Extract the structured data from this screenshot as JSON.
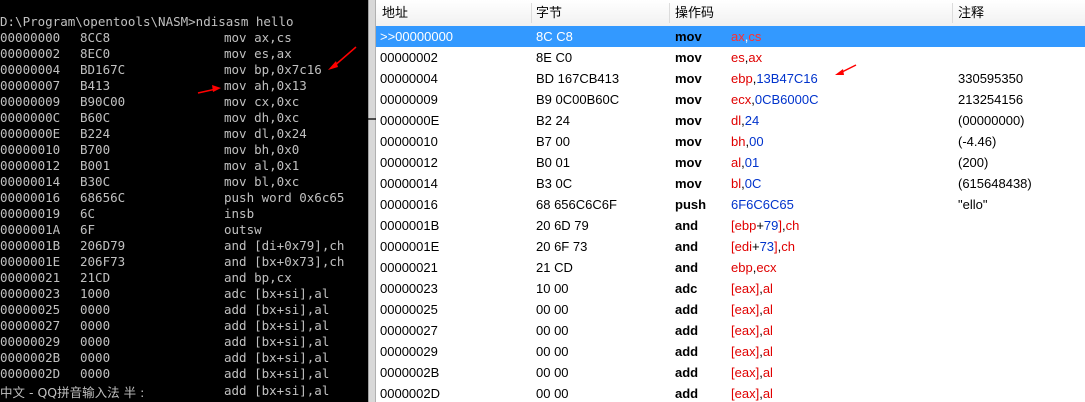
{
  "console": {
    "prompt": "D:\\Program\\opentools\\NASM>ndisasm hello",
    "lines": [
      {
        "addr": "00000000",
        "hex": "8CC8",
        "asm": "mov ax,cs"
      },
      {
        "addr": "00000002",
        "hex": "8EC0",
        "asm": "mov es,ax"
      },
      {
        "addr": "00000004",
        "hex": "BD167C",
        "asm": "mov bp,0x7c16"
      },
      {
        "addr": "00000007",
        "hex": "B413",
        "asm": "mov ah,0x13"
      },
      {
        "addr": "00000009",
        "hex": "B90C00",
        "asm": "mov cx,0xc"
      },
      {
        "addr": "0000000C",
        "hex": "B60C",
        "asm": "mov dh,0xc"
      },
      {
        "addr": "0000000E",
        "hex": "B224",
        "asm": "mov dl,0x24"
      },
      {
        "addr": "00000010",
        "hex": "B700",
        "asm": "mov bh,0x0"
      },
      {
        "addr": "00000012",
        "hex": "B001",
        "asm": "mov al,0x1"
      },
      {
        "addr": "00000014",
        "hex": "B30C",
        "asm": "mov bl,0xc"
      },
      {
        "addr": "00000016",
        "hex": "68656C",
        "asm": "push word 0x6c65"
      },
      {
        "addr": "00000019",
        "hex": "6C",
        "asm": "insb"
      },
      {
        "addr": "0000001A",
        "hex": "6F",
        "asm": "outsw"
      },
      {
        "addr": "0000001B",
        "hex": "206D79",
        "asm": "and [di+0x79],ch"
      },
      {
        "addr": "0000001E",
        "hex": "206F73",
        "asm": "and [bx+0x73],ch"
      },
      {
        "addr": "00000021",
        "hex": "21CD",
        "asm": "and bp,cx"
      },
      {
        "addr": "00000023",
        "hex": "1000",
        "asm": "adc [bx+si],al"
      },
      {
        "addr": "00000025",
        "hex": "0000",
        "asm": "add [bx+si],al"
      },
      {
        "addr": "00000027",
        "hex": "0000",
        "asm": "add [bx+si],al"
      },
      {
        "addr": "00000029",
        "hex": "0000",
        "asm": "add [bx+si],al"
      },
      {
        "addr": "0000002B",
        "hex": "0000",
        "asm": "add [bx+si],al"
      },
      {
        "addr": "0000002D",
        "hex": "0000",
        "asm": "add [bx+si],al"
      }
    ],
    "ime_status": "中文 - QQ拼音输入法 半 :",
    "last_line_asm": "add [bx+si],al"
  },
  "grid": {
    "headers": {
      "addr": "地址",
      "bytes": "字节",
      "opcode": "操作码",
      "comment": "注释"
    },
    "rows": [
      {
        "addr": ">>00000000",
        "bytes": "8C C8",
        "op": "mov",
        "args": [
          [
            "reg",
            "ax"
          ],
          [
            "sym",
            ","
          ],
          [
            "reg",
            "cs"
          ]
        ],
        "cmt": ""
      },
      {
        "addr": "00000002",
        "bytes": "8E C0",
        "op": "mov",
        "args": [
          [
            "reg",
            "es"
          ],
          [
            "sym",
            ","
          ],
          [
            "reg",
            "ax"
          ]
        ],
        "cmt": ""
      },
      {
        "addr": "00000004",
        "bytes": "BD 167CB413",
        "op": "mov",
        "args": [
          [
            "reg",
            "ebp"
          ],
          [
            "sym",
            ","
          ],
          [
            "num",
            "13B47C16"
          ]
        ],
        "cmt": "330595350"
      },
      {
        "addr": "00000009",
        "bytes": "B9 0C00B60C",
        "op": "mov",
        "args": [
          [
            "reg",
            "ecx"
          ],
          [
            "sym",
            ","
          ],
          [
            "num",
            "0CB6000C"
          ]
        ],
        "cmt": "213254156"
      },
      {
        "addr": "0000000E",
        "bytes": "B2 24",
        "op": "mov",
        "args": [
          [
            "reg",
            "dl"
          ],
          [
            "sym",
            ","
          ],
          [
            "num",
            "24"
          ]
        ],
        "cmt": "(00000000)"
      },
      {
        "addr": "00000010",
        "bytes": "B7 00",
        "op": "mov",
        "args": [
          [
            "reg",
            "bh"
          ],
          [
            "sym",
            ","
          ],
          [
            "num",
            "00"
          ]
        ],
        "cmt": "(-4.46)"
      },
      {
        "addr": "00000012",
        "bytes": "B0 01",
        "op": "mov",
        "args": [
          [
            "reg",
            "al"
          ],
          [
            "sym",
            ","
          ],
          [
            "num",
            "01"
          ]
        ],
        "cmt": "(200)"
      },
      {
        "addr": "00000014",
        "bytes": "B3 0C",
        "op": "mov",
        "args": [
          [
            "reg",
            "bl"
          ],
          [
            "sym",
            ","
          ],
          [
            "num",
            "0C"
          ]
        ],
        "cmt": "(615648438)"
      },
      {
        "addr": "00000016",
        "bytes": "68 656C6C6F",
        "op": "push",
        "args": [
          [
            "num",
            "6F6C6C65"
          ]
        ],
        "cmt": "\"ello\""
      },
      {
        "addr": "0000001B",
        "bytes": "20 6D 79",
        "op": "and",
        "args": [
          [
            "reg",
            "[ebp"
          ],
          [
            "sym",
            "+"
          ],
          [
            "num",
            "79"
          ],
          [
            "reg",
            "]"
          ],
          [
            "sym",
            ","
          ],
          [
            "reg",
            "ch"
          ]
        ],
        "cmt": ""
      },
      {
        "addr": "0000001E",
        "bytes": "20 6F 73",
        "op": "and",
        "args": [
          [
            "reg",
            "[edi"
          ],
          [
            "sym",
            "+"
          ],
          [
            "num",
            "73"
          ],
          [
            "reg",
            "]"
          ],
          [
            "sym",
            ","
          ],
          [
            "reg",
            "ch"
          ]
        ],
        "cmt": ""
      },
      {
        "addr": "00000021",
        "bytes": "21 CD",
        "op": "and",
        "args": [
          [
            "reg",
            "ebp"
          ],
          [
            "sym",
            ","
          ],
          [
            "reg",
            "ecx"
          ]
        ],
        "cmt": ""
      },
      {
        "addr": "00000023",
        "bytes": "10 00",
        "op": "adc",
        "args": [
          [
            "reg",
            "[eax]"
          ],
          [
            "sym",
            ","
          ],
          [
            "reg",
            "al"
          ]
        ],
        "cmt": ""
      },
      {
        "addr": "00000025",
        "bytes": "00 00",
        "op": "add",
        "args": [
          [
            "reg",
            "[eax]"
          ],
          [
            "sym",
            ","
          ],
          [
            "reg",
            "al"
          ]
        ],
        "cmt": ""
      },
      {
        "addr": "00000027",
        "bytes": "00 00",
        "op": "add",
        "args": [
          [
            "reg",
            "[eax]"
          ],
          [
            "sym",
            ","
          ],
          [
            "reg",
            "al"
          ]
        ],
        "cmt": ""
      },
      {
        "addr": "00000029",
        "bytes": "00 00",
        "op": "add",
        "args": [
          [
            "reg",
            "[eax]"
          ],
          [
            "sym",
            ","
          ],
          [
            "reg",
            "al"
          ]
        ],
        "cmt": ""
      },
      {
        "addr": "0000002B",
        "bytes": "00 00",
        "op": "add",
        "args": [
          [
            "reg",
            "[eax]"
          ],
          [
            "sym",
            ","
          ],
          [
            "reg",
            "al"
          ]
        ],
        "cmt": ""
      },
      {
        "addr": "0000002D",
        "bytes": "00 00",
        "op": "add",
        "args": [
          [
            "reg",
            "[eax]"
          ],
          [
            "sym",
            ","
          ],
          [
            "reg",
            "al"
          ]
        ],
        "cmt": ""
      }
    ]
  },
  "colors": {
    "selection": "#3399ff",
    "register": "#e00000",
    "number": "#0033cc",
    "arrow": "#ff0000",
    "console_bg": "#000000",
    "console_fg": "#c0c0c0"
  },
  "icons": {
    "divider": "resize-horizontal-icon",
    "annotation": "red-arrow-icon"
  }
}
